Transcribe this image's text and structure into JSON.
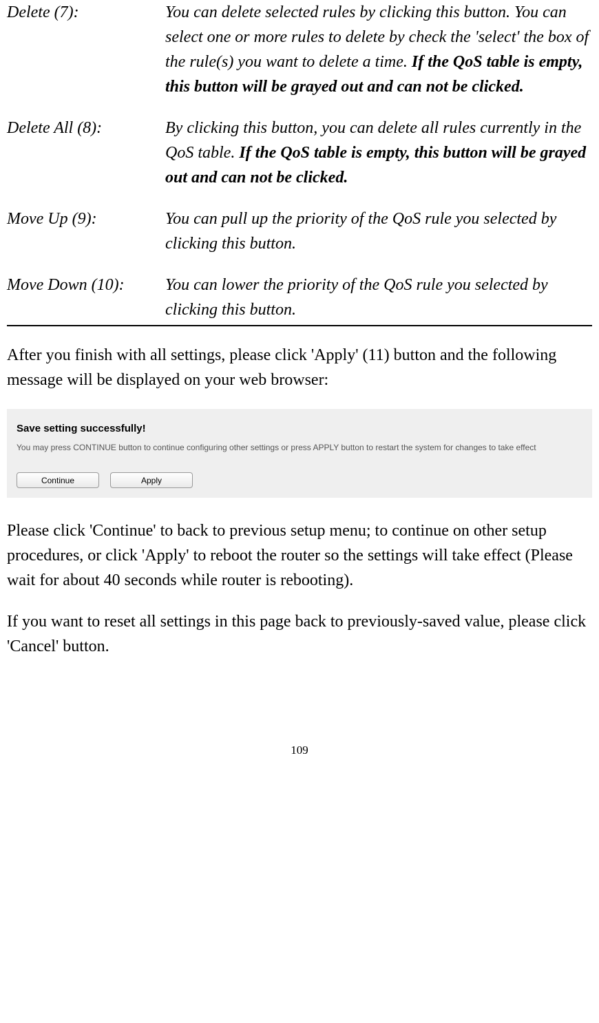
{
  "definitions": [
    {
      "term": "Delete (7):",
      "desc_normal": "You can delete selected rules by clicking this button. You can select one or more rules to delete by check the 'select' the box of the rule(s) you want to delete a time. ",
      "desc_bold": "If the QoS table is empty, this button will be grayed out and can not be clicked."
    },
    {
      "term": "Delete All (8):",
      "desc_normal": "By clicking this button, you can delete all rules currently in the QoS table. ",
      "desc_bold": "If the QoS table is empty, this button will be grayed out and can not be clicked."
    },
    {
      "term": "Move Up (9):",
      "desc_normal": "You can pull up the priority of the QoS rule you selected by clicking this button.",
      "desc_bold": ""
    },
    {
      "term": "Move Down (10):",
      "desc_normal": "You can lower the priority of the QoS rule you selected by clicking this button.",
      "desc_bold": ""
    }
  ],
  "paragraph_after_defs": "After you finish with all settings, please click 'Apply' (11) button and the following message will be displayed on your web browser:",
  "dialog": {
    "title": "Save setting successfully!",
    "text": "You may press CONTINUE button to continue configuring other settings or press APPLY button to restart the system for changes to take effect",
    "continue_label": "Continue",
    "apply_label": "Apply"
  },
  "paragraph_continue": "Please click 'Continue' to back to previous setup menu; to continue on other setup procedures, or click 'Apply' to reboot the router so the settings will take effect (Please wait for about 40 seconds while router is rebooting).",
  "paragraph_reset": "If you want to reset all settings in this page back to previously-saved value, please click 'Cancel' button.",
  "page_number": "109"
}
